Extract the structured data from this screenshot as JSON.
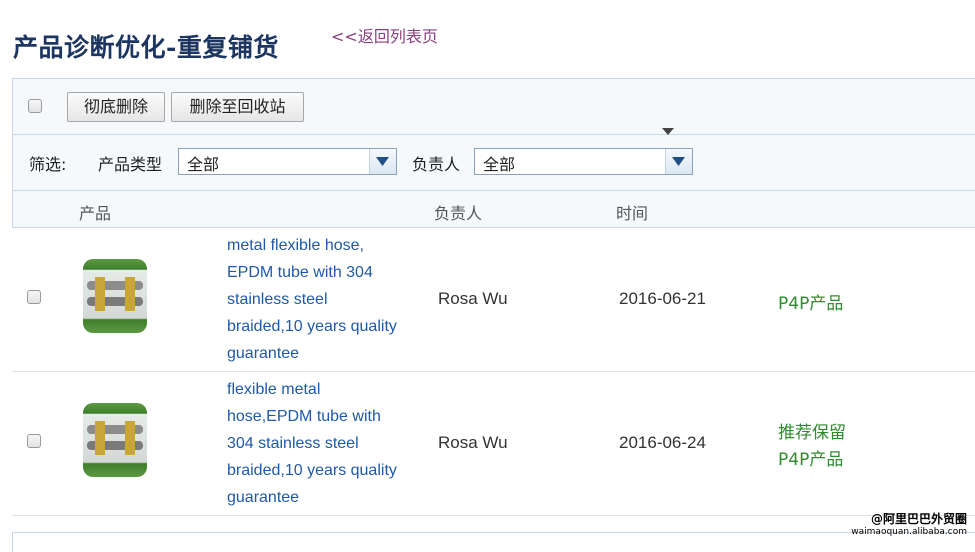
{
  "page": {
    "title": "产品诊断优化-重复铺货",
    "back_link": "<<返回列表页"
  },
  "toolbar": {
    "delete_permanently": "彻底删除",
    "move_to_recycle_bin": "删除至回收站"
  },
  "filters": {
    "label": "筛选:",
    "product_type_label": "产品类型",
    "product_type_value": "全部",
    "owner_label": "负责人",
    "owner_value": "全部"
  },
  "table": {
    "columns": [
      "产品",
      "负责人",
      "时间"
    ],
    "sort_icon": "caret-down-icon",
    "rows": [
      {
        "thumb_icon": "hose-product-thumbnail",
        "product_lines": [
          "metal flexible hose,",
          "EPDM tube with 304",
          "stainless steel",
          "braided,10 years quality",
          "guarantee"
        ],
        "owner": "Rosa Wu",
        "date": "2016-06-21",
        "tags": [
          "P4P产品"
        ]
      },
      {
        "thumb_icon": "hose-product-thumbnail",
        "product_lines": [
          "flexible metal",
          "hose,EPDM tube with",
          "304 stainless steel",
          "braided,10 years quality",
          "guarantee"
        ],
        "owner": "Rosa Wu",
        "date": "2016-06-24",
        "tags": [
          "推荐保留",
          "P4P产品"
        ]
      }
    ]
  },
  "watermark": {
    "line1": "@阿里巴巴外贸圈",
    "line2": "waimaoquan.alibaba.com"
  },
  "colors": {
    "title": "#1d3561",
    "back_link": "#8a3f7f",
    "product_link": "#1f5aa6",
    "tag": "#2e8b2e",
    "panel_bg": "#f5f9fc",
    "border": "#c9d8e6"
  }
}
